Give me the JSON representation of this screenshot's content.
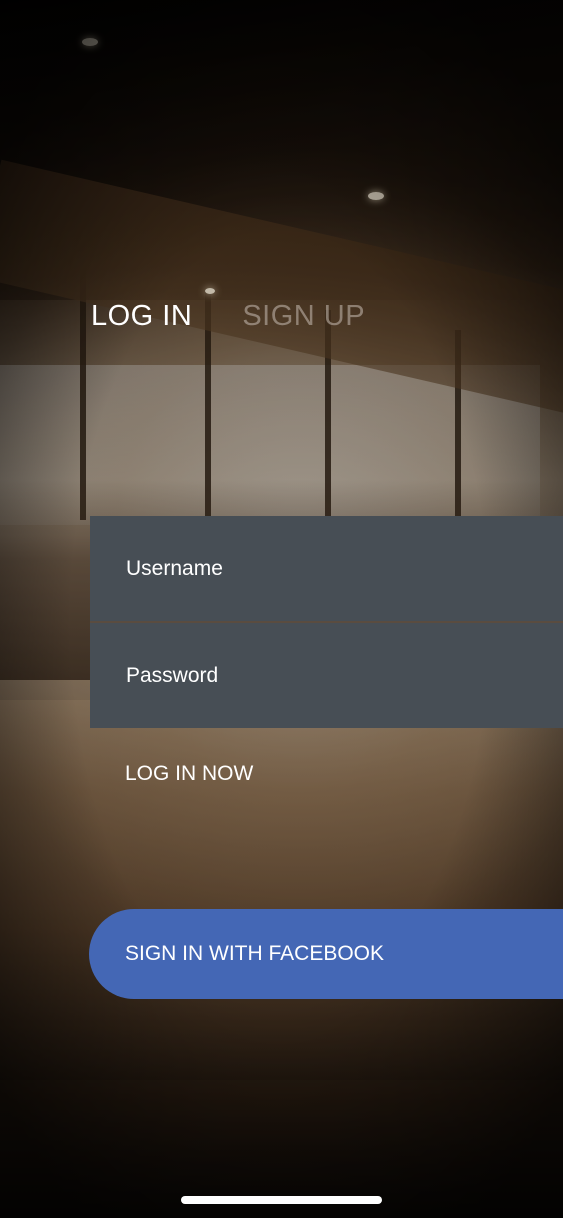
{
  "tabs": {
    "login_label": "LOG IN",
    "signup_label": "SIGN UP",
    "active": "login"
  },
  "form": {
    "username_placeholder": "Username",
    "password_placeholder": "Password",
    "login_now_label": "LOG IN NOW"
  },
  "facebook": {
    "label": "SIGN IN WITH FACEBOOK",
    "color": "#4467b5"
  },
  "colors": {
    "field_background": "#474e55",
    "text": "#ffffff"
  }
}
